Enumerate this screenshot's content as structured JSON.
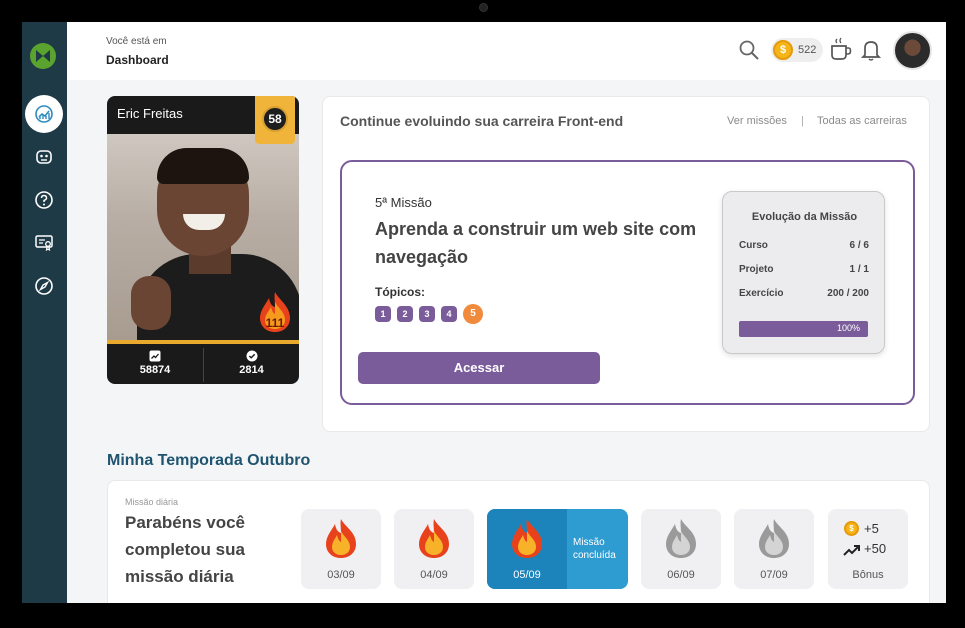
{
  "header": {
    "breadcrumb_label": "Você está em",
    "breadcrumb_title": "Dashboard",
    "coins": "522",
    "coin_symbol": "$"
  },
  "sidebar": {
    "items": [
      {
        "icon": "dashboard-chart-icon",
        "active": true
      },
      {
        "icon": "mask-icon",
        "active": false
      },
      {
        "icon": "help-icon",
        "active": false
      },
      {
        "icon": "certificate-icon",
        "active": false
      },
      {
        "icon": "compass-icon",
        "active": false
      }
    ]
  },
  "profile": {
    "name": "Eric Freitas",
    "level": "58",
    "streak": "111",
    "stats": [
      {
        "icon": "trending-up-icon",
        "value": "58874"
      },
      {
        "icon": "check-circle-icon",
        "value": "2814"
      }
    ]
  },
  "mission_panel": {
    "title": "Continue evoluindo sua carreira Front-end",
    "links": [
      "Ver missões",
      "Todas as carreiras"
    ],
    "separator": "|",
    "mission": {
      "number": "5ª Missão",
      "title": "Aprenda a construir um web site com navegação",
      "topics_label": "Tópicos:",
      "topics": [
        "1",
        "2",
        "3",
        "4",
        "5"
      ],
      "current_topic": "5",
      "button": "Acessar"
    },
    "evolution": {
      "title": "Evolução da Missão",
      "rows": [
        {
          "label": "Curso",
          "value": "6 / 6"
        },
        {
          "label": "Projeto",
          "value": "1 / 1"
        },
        {
          "label": "Exercício",
          "value": "200 / 200"
        }
      ],
      "progress_label": "100%",
      "progress": 1.0
    }
  },
  "season": {
    "title": "Minha Temporada Outubro",
    "daily_label": "Missão diária",
    "daily_text": "Parabéns você completou sua missão diária",
    "days": [
      {
        "date": "03/09",
        "status": "done"
      },
      {
        "date": "04/09",
        "status": "done"
      },
      {
        "date": "05/09",
        "status": "today",
        "note": "Missão concluída"
      },
      {
        "date": "06/09",
        "status": "locked"
      },
      {
        "date": "07/09",
        "status": "locked"
      }
    ],
    "bonus": {
      "coins": "+5",
      "xp": "+50",
      "label": "Bônus"
    }
  },
  "colors": {
    "sidebar": "#1f3a47",
    "accent_purple": "#7b5c9a",
    "today_blue": "#2e9bd1",
    "season_title": "#1f5470",
    "topic_current": "#f08a3c"
  }
}
